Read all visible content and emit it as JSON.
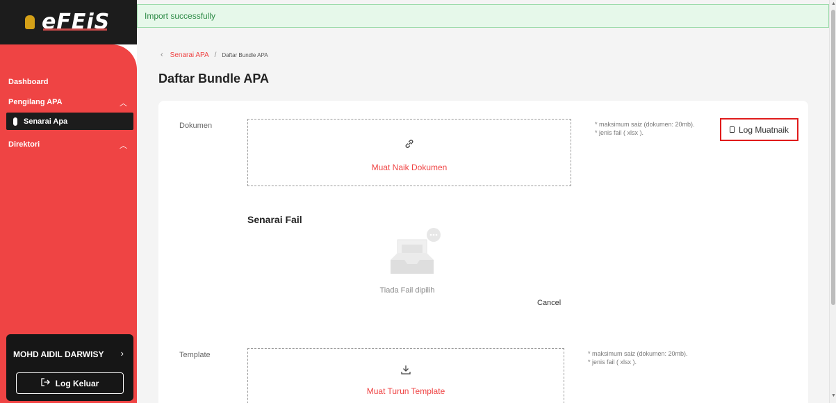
{
  "sidebar": {
    "logo_text": "eFEiS",
    "items": [
      {
        "label": "Dashboard"
      },
      {
        "label": "Pengilang APA"
      },
      {
        "label": "Senarai Apa"
      },
      {
        "label": "Direktori"
      }
    ],
    "user_name": "MOHD AIDIL DARWISY",
    "logout_label": "Log Keluar"
  },
  "toast": {
    "message": "Import successfully"
  },
  "breadcrumb": {
    "parent": "Senarai APA",
    "separator": "/",
    "current": "Daftar Bundle APA"
  },
  "page_title": "Daftar Bundle APA",
  "dokumen": {
    "label": "Dokumen",
    "upload_text": "Muat Naik Dokumen",
    "hint_size": "* maksimum saiz (dokumen: 20mb).",
    "hint_type": "* jenis fail ( xlsx )."
  },
  "log_button": {
    "label": "Log Muatnaik"
  },
  "files": {
    "title": "Senarai Fail",
    "empty_text": "Tiada Fail dipilih",
    "cancel_label": "Cancel"
  },
  "template": {
    "label": "Template",
    "download_text": "Muat Turun Template",
    "hint_size": "* maksimum saiz (dokumen: 20mb).",
    "hint_type": "* jenis fail ( xlsx )."
  },
  "colors": {
    "brand_red": "#ef4444",
    "sidebar_dark": "#1c1c1c",
    "toast_bg": "#e6f8ea",
    "highlight_border": "#e01b1b"
  },
  "icons": {
    "link": "link-icon",
    "download": "download-icon",
    "clipboard": "clipboard-icon",
    "logout": "logout-icon"
  }
}
